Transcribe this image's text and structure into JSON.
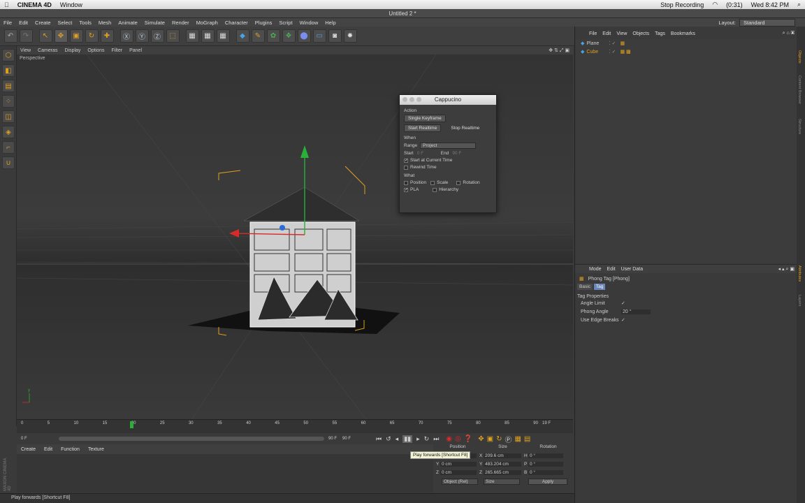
{
  "mac_menubar": {
    "apple": "",
    "app": "CINEMA 4D",
    "menu": "Window",
    "status_recording": "Stop Recording",
    "battery": "(0:31)",
    "clock": "Wed 8:42 PM"
  },
  "window": {
    "title": "Untitled 2 *"
  },
  "menus": [
    "File",
    "Edit",
    "Create",
    "Select",
    "Tools",
    "Mesh",
    "Animate",
    "Simulate",
    "Render",
    "MoGraph",
    "Character",
    "Plugins",
    "Script",
    "Window",
    "Help"
  ],
  "layout": {
    "label": "Layout:",
    "value": "Standard"
  },
  "viewport": {
    "menu": [
      "View",
      "Cameras",
      "Display",
      "Options",
      "Filter",
      "Panel"
    ],
    "label": "Perspective"
  },
  "timeline": {
    "ticks": [
      "0",
      "5",
      "10",
      "15",
      "20",
      "25",
      "30",
      "35",
      "40",
      "45",
      "50",
      "55",
      "60",
      "65",
      "70",
      "75",
      "80",
      "85",
      "90"
    ],
    "current_frame": "19 F",
    "start_field": "0 F",
    "end_field": "90 F",
    "range_label": "90 F"
  },
  "material_manager": {
    "menu": [
      "Create",
      "Edit",
      "Function",
      "Texture"
    ]
  },
  "coordinates": {
    "headers": [
      "Position",
      "Size",
      "Rotation"
    ],
    "rows": [
      {
        "axis": "X",
        "pos": "0 cm",
        "size_axis": "X",
        "size": "209.6 cm",
        "rot_axis": "H",
        "rot": "0 °"
      },
      {
        "axis": "Y",
        "pos": "0 cm",
        "size_axis": "Y",
        "size": "483.204 cm",
        "rot_axis": "P",
        "rot": "0 °"
      },
      {
        "axis": "Z",
        "pos": "0 cm",
        "size_axis": "Z",
        "size": "265.665 cm",
        "rot_axis": "B",
        "rot": "0 °"
      }
    ],
    "mode_select": "Object (Rel)",
    "size_select": "Size",
    "apply": "Apply"
  },
  "tooltip": "Play forwards [Shortcut F8]",
  "status": "Play forwards [Shortcut F8]",
  "object_manager": {
    "menu": [
      "File",
      "Edit",
      "View",
      "Objects",
      "Tags",
      "Bookmarks"
    ],
    "objects": [
      "Plane",
      "Cube"
    ]
  },
  "attributes": {
    "menu": [
      "Mode",
      "Edit",
      "User Data"
    ],
    "tag_title": "Phong Tag [Phong]",
    "tabs": [
      "Basic",
      "Tag"
    ],
    "section": "Tag Properties",
    "props": [
      {
        "label": "Angle Limit",
        "value": "✓"
      },
      {
        "label": "Phong Angle",
        "value": "20 °"
      },
      {
        "label": "Use Edge Breaks",
        "value": "✓"
      }
    ]
  },
  "cappucino": {
    "title": "Cappucino",
    "action_label": "Action",
    "single_keyframe": "Single Keyframe",
    "start_realtime": "Start Realtime",
    "stop_realtime": "Stop Realtime",
    "when_label": "When",
    "range_label": "Range",
    "range_value": "Project",
    "start_label": "Start",
    "start_value": "0 F",
    "end_label": "End",
    "end_value": "90 F",
    "start_at_current": "Start at Current Time",
    "rewind": "Rewind Time",
    "what_label": "What",
    "position": "Position",
    "scale": "Scale",
    "rotation": "Rotation",
    "pla": "PLA",
    "hierarchy": "Hierarchy"
  },
  "side_tabs": [
    "Objects",
    "Content Browser",
    "Structure",
    "Attributes",
    "Layers"
  ],
  "logo": "MAXON CINEMA 4D",
  "colors": {
    "accent": "#e0a020",
    "grid_green": "#2ab03a",
    "tooltip_bg": "#f3f3d6"
  }
}
